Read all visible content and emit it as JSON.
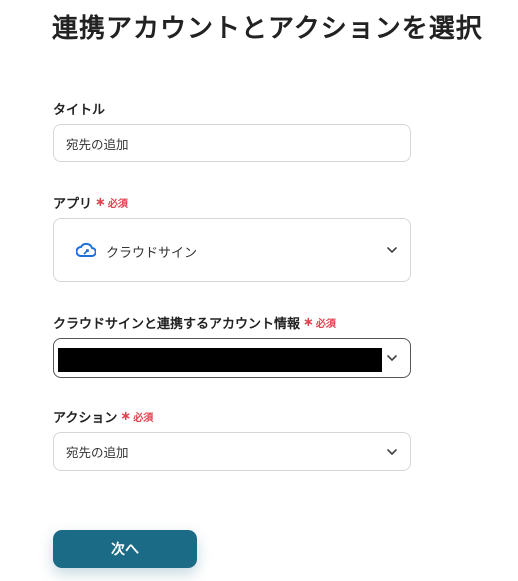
{
  "page": {
    "title": "連携アカウントとアクションを選択"
  },
  "form": {
    "title_field": {
      "label": "タイトル",
      "value": "宛先の追加"
    },
    "app_field": {
      "label": "アプリ",
      "required_label": "必須",
      "value": "クラウドサイン",
      "icon": "cloudsign-logo-icon"
    },
    "account_field": {
      "label": "クラウドサインと連携するアカウント情報",
      "required_label": "必須",
      "value_redacted": true
    },
    "action_field": {
      "label": "アクション",
      "required_label": "必須",
      "value": "宛先の追加"
    }
  },
  "buttons": {
    "next_label": "次へ"
  },
  "colors": {
    "accent": "#1b6b87",
    "required": "#e0424d",
    "border": "#d3d6da"
  }
}
